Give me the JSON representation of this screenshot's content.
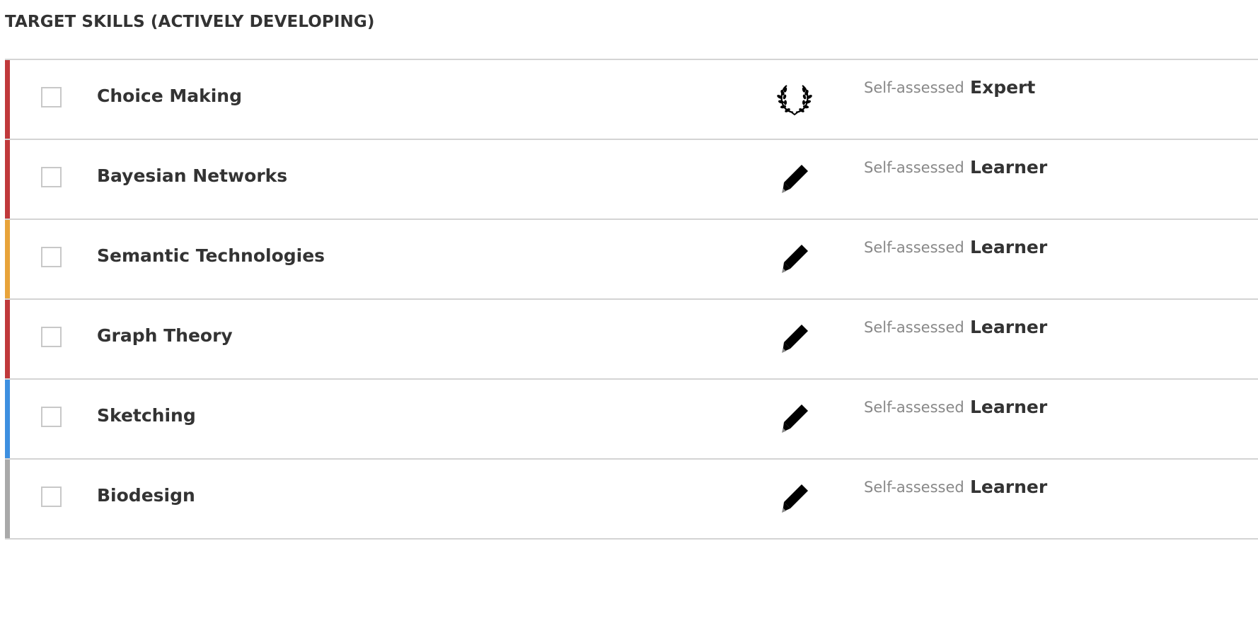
{
  "section": {
    "title": "TARGET SKILLS (ACTIVELY DEVELOPING)"
  },
  "skills": [
    {
      "name": "Choice Making",
      "accent": "#c0393b",
      "icon": "laurel-wreath-icon",
      "assessed_label": "Self-assessed",
      "level": "Expert"
    },
    {
      "name": "Bayesian Networks",
      "accent": "#c0393b",
      "icon": "pencil-icon",
      "assessed_label": "Self-assessed",
      "level": "Learner"
    },
    {
      "name": "Semantic Technologies",
      "accent": "#e8a33a",
      "icon": "pencil-icon",
      "assessed_label": "Self-assessed",
      "level": "Learner"
    },
    {
      "name": "Graph Theory",
      "accent": "#c0393b",
      "icon": "pencil-icon",
      "assessed_label": "Self-assessed",
      "level": "Learner"
    },
    {
      "name": "Sketching",
      "accent": "#3d8fe0",
      "icon": "pencil-icon",
      "assessed_label": "Self-assessed",
      "level": "Learner"
    },
    {
      "name": "Biodesign",
      "accent": "#a9a9a9",
      "icon": "pencil-icon",
      "assessed_label": "Self-assessed",
      "level": "Learner"
    }
  ]
}
